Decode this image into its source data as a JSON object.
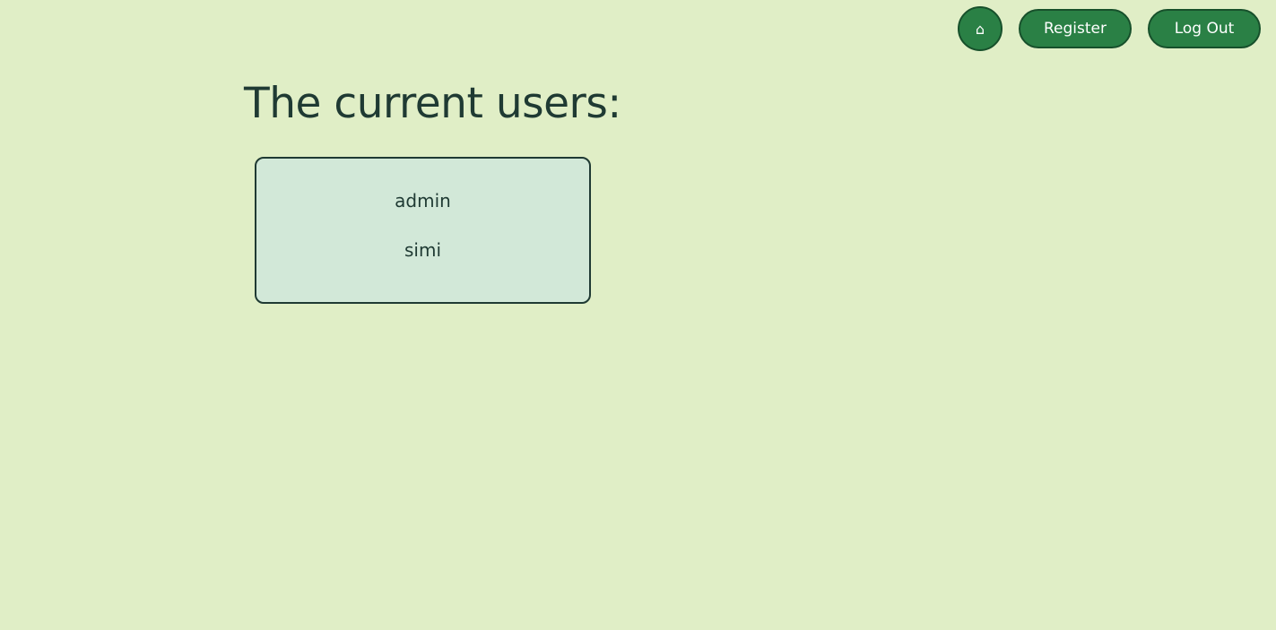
{
  "nav": {
    "home_icon": "⌂",
    "home_icon_name": "home-icon",
    "register_label": "Register",
    "logout_label": "Log Out"
  },
  "main": {
    "title": "The current users:",
    "users": [
      "admin",
      "simi"
    ]
  },
  "colors": {
    "background": "#e0eec6",
    "button": "#2a8045",
    "button_border": "#17502b",
    "box_background": "#d2e8d8",
    "text": "#1f3a33"
  }
}
